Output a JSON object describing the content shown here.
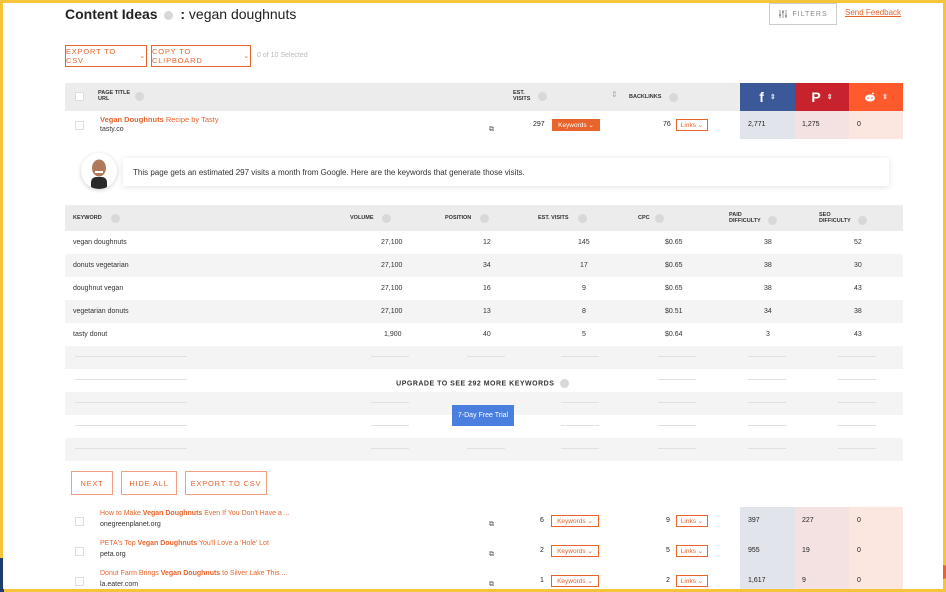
{
  "header": {
    "title": "Content Ideas",
    "separator": ":",
    "keyword": "vegan doughnuts",
    "filters_label": "FILTERS",
    "feedback_label": "Send Feedback"
  },
  "toolbar": {
    "export_label": "EXPORT TO CSV",
    "copy_label": "COPY TO CLIPBOARD",
    "selected_text": "0 of 10 Selected"
  },
  "table_header": {
    "page_title": "PAGE TITLE",
    "url": "URL",
    "est": "EST.",
    "visits": "VISITS",
    "backlinks": "BACKLINKS",
    "facebook_icon": "f",
    "pinterest_icon": "P",
    "reddit_icon": "reddit-icon"
  },
  "first_result": {
    "title_bold": "Vegan Doughnuts",
    "title_rest": " Recipe by Tasty",
    "domain": "tasty.co",
    "visits": "297",
    "keywords_label": "Keywords",
    "backlinks": "76",
    "links_label": "Links",
    "facebook": "2,771",
    "pinterest": "1,275",
    "reddit": "0"
  },
  "notice": {
    "text": "This page gets an estimated 297 visits a month from Google. Here are the keywords that generate those visits."
  },
  "keyword_table": {
    "headers": {
      "keyword": "KEYWORD",
      "volume": "VOLUME",
      "position": "POSITION",
      "est_visits": "EST. VISITS",
      "cpc": "CPC",
      "paid": "PAID",
      "seo": "SEO",
      "difficulty": "DIFFICULTY"
    },
    "rows": [
      {
        "keyword": "vegan doughnuts",
        "volume": "27,100",
        "position": "12",
        "visits": "145",
        "cpc": "$0.65",
        "paid": "38",
        "seo": "52"
      },
      {
        "keyword": "donuts vegetarian",
        "volume": "27,100",
        "position": "34",
        "visits": "17",
        "cpc": "$0.65",
        "paid": "38",
        "seo": "30"
      },
      {
        "keyword": "doughnut vegan",
        "volume": "27,100",
        "position": "16",
        "visits": "9",
        "cpc": "$0.65",
        "paid": "38",
        "seo": "43"
      },
      {
        "keyword": "vegetarian donuts",
        "volume": "27,100",
        "position": "13",
        "visits": "8",
        "cpc": "$0.51",
        "paid": "34",
        "seo": "38"
      },
      {
        "keyword": "tasty donut",
        "volume": "1,900",
        "position": "40",
        "visits": "5",
        "cpc": "$0.64",
        "paid": "3",
        "seo": "43"
      }
    ],
    "upgrade_text": "UPGRADE TO SEE 292 MORE KEYWORDS",
    "trial_label": "7-Day Free Trial",
    "next_label": "NEXT",
    "hide_all_label": "HIDE ALL",
    "export_label": "EXPORT TO CSV"
  },
  "more_results": [
    {
      "pre": "How to Make ",
      "bold": "Vegan Doughnuts",
      "post": " Even If You Don't Have a ...",
      "domain": "onegreenplanet.org",
      "visits": "6",
      "keywords_label": "Keywords",
      "backlinks": "9",
      "links_label": "Links",
      "facebook": "397",
      "pinterest": "227",
      "reddit": "0"
    },
    {
      "pre": "PETA's Top ",
      "bold": "Vegan Doughnuts",
      "post": " You'll Love a 'Hole' Lot",
      "domain": "peta.org",
      "visits": "2",
      "keywords_label": "Keywords",
      "backlinks": "5",
      "links_label": "Links",
      "facebook": "955",
      "pinterest": "19",
      "reddit": "0"
    },
    {
      "pre": "Donut Farm Brings ",
      "bold": "Vegan Doughnuts",
      "post": " to Silver Lake This ...",
      "domain": "la.eater.com",
      "visits": "1",
      "keywords_label": "Keywords",
      "backlinks": "2",
      "links_label": "Links",
      "facebook": "1,617",
      "pinterest": "9",
      "reddit": "0"
    }
  ],
  "colors": {
    "accent": "#e8642c",
    "facebook": "#3b5998",
    "pinterest": "#c8232c",
    "reddit": "#ff5a2c",
    "trial": "#4a7fe0"
  }
}
